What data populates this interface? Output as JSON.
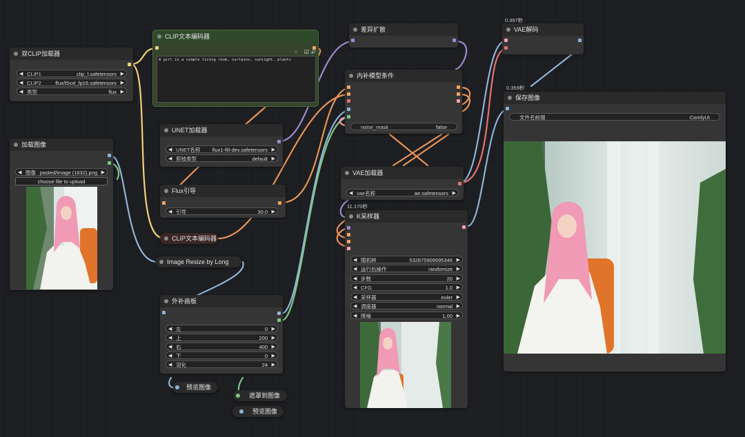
{
  "nodes": {
    "dual_clip": {
      "title": "双CLIP加载器",
      "clip1_label": "CLIP1",
      "clip1_value": "clip_l.safetensors",
      "clip2_label": "CLIP2",
      "clip2_value": "flux/t5xxl_fp16.safetensors",
      "type_label": "类型",
      "type_value": "flux"
    },
    "clip_text_1": {
      "title": "CLIP文本编码器",
      "prompt": "A girl is a simple living room, curtains, sunlight, plants"
    },
    "unet": {
      "title": "UNET加载器",
      "name_label": "UNET名称",
      "name_value": "flux1-fill-dev.safetensors",
      "dtype_label": "剪枝类型",
      "dtype_value": "default"
    },
    "flux_guidance": {
      "title": "Flux引导",
      "guidance_label": "引导",
      "guidance_value": "30.0"
    },
    "clip_text_2": {
      "title": "CLIP文本编码器"
    },
    "load_image": {
      "title": "加载图像",
      "image_label": "图像",
      "image_value": "pasted/image (1632).png",
      "upload_label": "choose file to upload"
    },
    "image_resize": {
      "title": "Image Resize by Long"
    },
    "outpaint_canvas": {
      "title": "外补画板",
      "left_label": "左",
      "left_value": "0",
      "top_label": "上",
      "top_value": "200",
      "right_label": "右",
      "right_value": "400",
      "bottom_label": "下",
      "bottom_value": "0",
      "feather_label": "羽化",
      "feather_value": "24"
    },
    "preview_1": {
      "title": "预览图像"
    },
    "mask_to_image": {
      "title": "遮罩到图像"
    },
    "preview_2": {
      "title": "预览图像"
    },
    "diff_expand": {
      "title": "差异扩散"
    },
    "inpaint_cond": {
      "title": "内补模型条件",
      "noise_mask_label": "noise_mask",
      "noise_mask_value": "false"
    },
    "vae_loader": {
      "title": "VAE加载器",
      "vae_label": "vae名称",
      "vae_value": "ae.safetensors"
    },
    "ksampler": {
      "title": "K采样器",
      "timing": "11.170秒",
      "seed_label": "随机种",
      "seed_value": "532875909695346",
      "after_label": "运行后操作",
      "after_value": "randomize",
      "steps_label": "步数",
      "steps_value": "20",
      "cfg_label": "CFG",
      "cfg_value": "1.0",
      "sampler_label": "采样器",
      "sampler_value": "euler",
      "scheduler_label": "调度器",
      "scheduler_value": "normal",
      "denoise_label": "降噪",
      "denoise_value": "1.00"
    },
    "vae_decode": {
      "title": "VAE解码",
      "timing": "0.397秒"
    },
    "save_image": {
      "title": "保存图像",
      "timing": "0.359秒",
      "prefix_label": "文件名前缀",
      "prefix_value": "ComfyUI"
    }
  },
  "icons": {
    "arrow_left": "◀",
    "arrow_right": "▶",
    "circle": "○",
    "check": "☑",
    "speaker": "🔊"
  },
  "colors": {
    "clip": "#f0d27a",
    "model": "#b39ddb",
    "conditioning": "#f4a460",
    "image": "#8fb3d9",
    "latent": "#ff9fb0",
    "vae": "#ff6b6b",
    "mask": "#81c784"
  }
}
